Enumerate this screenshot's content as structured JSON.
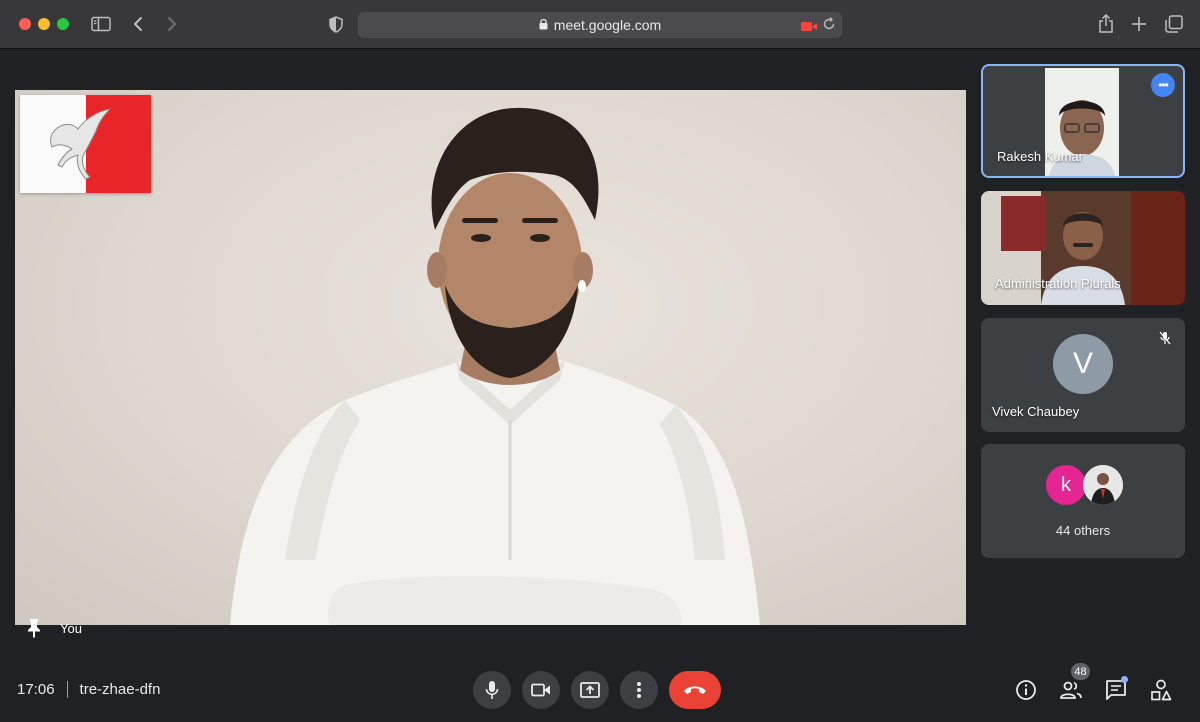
{
  "browser": {
    "url": "meet.google.com"
  },
  "meeting": {
    "time": "17:06",
    "code": "tre-zhae-dfn",
    "self_label": "You",
    "participant_count": "48"
  },
  "participants": [
    {
      "name": "Rakesh Kumar"
    },
    {
      "name": "Administration Plurals"
    },
    {
      "name": "Vivek Chaubey",
      "initial": "V"
    }
  ],
  "others": {
    "initial": "k",
    "label": "44 others"
  },
  "icons": {
    "sidebar": "sidebar-icon",
    "back": "chevron-left-icon",
    "forward": "chevron-right-icon",
    "shield": "shield-icon",
    "share": "share-icon",
    "new_tab": "plus-icon",
    "tabs": "tabs-icon",
    "mic": "mic-icon",
    "camera": "camera-icon",
    "present": "present-icon",
    "more": "more-vert-icon",
    "end_call": "end-call-icon",
    "info": "info-icon",
    "people": "people-icon",
    "chat": "chat-icon",
    "activities": "activities-icon"
  },
  "colors": {
    "end_call": "#ea4335",
    "active_border": "#8ab4f8",
    "more_button": "#4285f4",
    "avatar_k": "#e52592"
  }
}
